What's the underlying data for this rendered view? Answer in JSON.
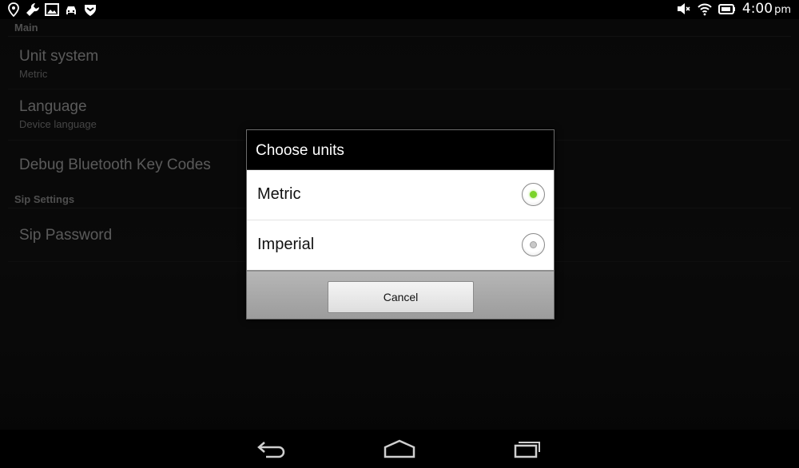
{
  "status_bar": {
    "left_icons": [
      "location-icon",
      "wrench-icon",
      "image-icon",
      "car-icon",
      "shield-icon"
    ],
    "right_icons": [
      "mute-icon",
      "wifi-icon",
      "battery-icon"
    ],
    "time": "4:00",
    "ampm": "pm"
  },
  "settings": {
    "sections": [
      {
        "header": "Main"
      },
      {
        "header": "Sip Settings"
      }
    ],
    "items": [
      {
        "title": "Unit system",
        "summary": "Metric"
      },
      {
        "title": "Language",
        "summary": "Device language"
      },
      {
        "title": "Debug Bluetooth Key Codes",
        "summary": ""
      },
      {
        "title": "Sip Password",
        "summary": ""
      }
    ]
  },
  "dialog": {
    "title": "Choose units",
    "options": [
      {
        "label": "Metric",
        "selected": true
      },
      {
        "label": "Imperial",
        "selected": false
      }
    ],
    "cancel_label": "Cancel"
  },
  "nav_bar": {
    "buttons": [
      "back-icon",
      "home-icon",
      "recent-apps-icon"
    ]
  },
  "colors": {
    "radio_selected": "#7bd32a",
    "dialog_title_bg": "#000000",
    "button_bar_bg": "#a8a8a8"
  }
}
